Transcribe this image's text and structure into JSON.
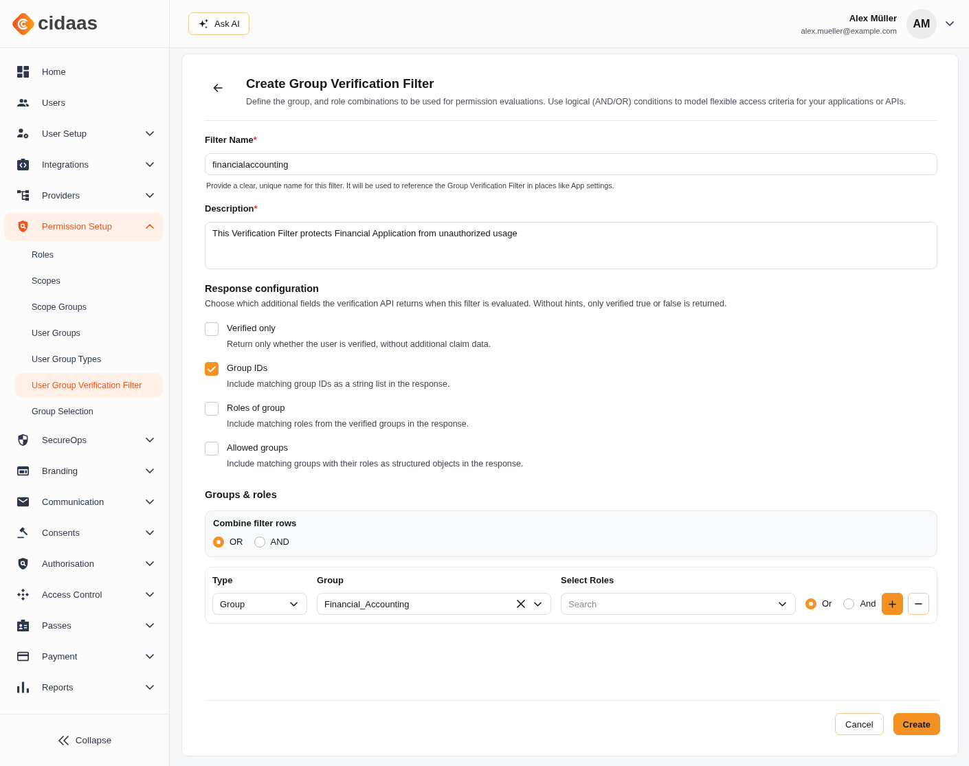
{
  "logo": {
    "text": "cidaas"
  },
  "sidebar": {
    "items": [
      {
        "label": "Home",
        "kind": "link",
        "selected": false
      },
      {
        "label": "Users",
        "kind": "link",
        "selected": false
      },
      {
        "label": "User Setup",
        "kind": "group",
        "selected": false,
        "expanded": false
      },
      {
        "label": "Integrations",
        "kind": "group",
        "selected": false,
        "expanded": false
      },
      {
        "label": "Providers",
        "kind": "group",
        "selected": false,
        "expanded": false
      },
      {
        "label": "Permission Setup",
        "kind": "group",
        "selected": true,
        "expanded": true,
        "children": [
          {
            "label": "Roles",
            "selected": false
          },
          {
            "label": "Scopes",
            "selected": false
          },
          {
            "label": "Scope Groups",
            "selected": false
          },
          {
            "label": "User Groups",
            "selected": false
          },
          {
            "label": "User Group Types",
            "selected": false
          },
          {
            "label": "User Group Verification Filter",
            "selected": true
          },
          {
            "label": "Group Selection",
            "selected": false
          }
        ]
      },
      {
        "label": "SecureOps",
        "kind": "group",
        "selected": false,
        "expanded": false
      },
      {
        "label": "Branding",
        "kind": "group",
        "selected": false,
        "expanded": false
      },
      {
        "label": "Communication",
        "kind": "group",
        "selected": false,
        "expanded": false
      },
      {
        "label": "Consents",
        "kind": "group",
        "selected": false,
        "expanded": false
      },
      {
        "label": "Authorisation",
        "kind": "group",
        "selected": false,
        "expanded": false
      },
      {
        "label": "Access Control",
        "kind": "group",
        "selected": false,
        "expanded": false
      },
      {
        "label": "Passes",
        "kind": "group",
        "selected": false,
        "expanded": false
      },
      {
        "label": "Payment",
        "kind": "group",
        "selected": false,
        "expanded": false
      },
      {
        "label": "Reports",
        "kind": "group",
        "selected": false,
        "expanded": false
      }
    ],
    "collapse": {
      "label": "Collapse"
    }
  },
  "header": {
    "ask_ai": {
      "label": "Ask AI"
    },
    "user": {
      "name": "Alex Müller",
      "email": "alex.mueller@example.com",
      "initials": "AM"
    }
  },
  "page": {
    "title": "Create Group Verification Filter",
    "subtitle": "Define the group, and role combinations to be used for permission evaluations. Use logical (AND/OR) conditions to model flexible access criteria for your applications or APIs.",
    "fields": [
      {
        "kind": "input",
        "label": "Filter Name",
        "required_mark": "*",
        "value": "financialaccounting",
        "hint": "Provide a clear, unique name for this filter. It will be used to reference the Group Verification Filter in places like App settings."
      },
      {
        "kind": "textarea",
        "label": "Description",
        "required_mark": "*",
        "value": "This Verification Filter protects Financial Application from unauthorized usage"
      }
    ],
    "response_configuration": {
      "title": "Response configuration",
      "description": "Choose which additional fields the verification API returns when this filter is evaluated. Without hints, only verified true or false is returned.",
      "options": [
        {
          "label": "Verified only",
          "description": "Return only whether the user is verified, without additional claim data.",
          "checked": false
        },
        {
          "label": "Group IDs",
          "description": "Include matching group IDs as a string list in the response.",
          "checked": true
        },
        {
          "label": "Roles of group",
          "description": "Include matching roles from the verified groups in the response.",
          "checked": false
        },
        {
          "label": "Allowed groups",
          "description": "Include matching groups with their roles as structured objects in the response.",
          "checked": false
        }
      ]
    },
    "groups_roles": {
      "title": "Groups & roles",
      "combine": {
        "label": "Combine filter rows",
        "options": [
          {
            "label": "OR",
            "selected": true
          },
          {
            "label": "AND",
            "selected": false
          }
        ]
      },
      "filter_rows": [
        {
          "type": {
            "label": "Type",
            "value": "Group"
          },
          "group": {
            "label": "Group",
            "value": "Financial_Accounting"
          },
          "roles": {
            "label": "Select Roles",
            "placeholder": "Search"
          },
          "operators": [
            {
              "label": "Or",
              "selected": true
            },
            {
              "label": "And",
              "selected": false
            }
          ]
        }
      ]
    },
    "actions": [
      {
        "label": "Cancel",
        "kind": "secondary"
      },
      {
        "label": "Create",
        "kind": "primary"
      }
    ]
  }
}
